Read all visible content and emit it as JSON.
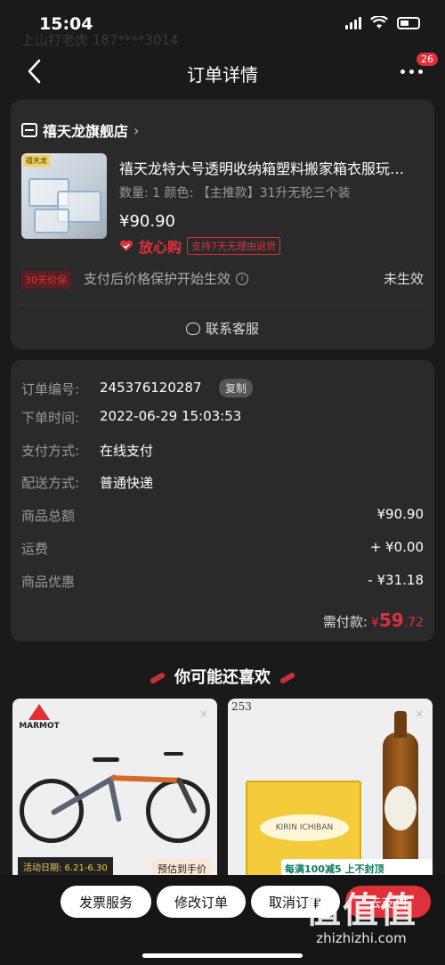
{
  "status_bar": {
    "time": "15:04"
  },
  "ghost": {
    "line1": "上山打老虎  187****3014",
    "line2": ""
  },
  "nav": {
    "title": "订单详情",
    "badge": "26"
  },
  "shop": {
    "name": "禧天龙旗舰店",
    "product": {
      "title": "禧天龙特大号透明收纳箱塑料搬家箱衣服玩…",
      "spec": "数量: 1  颜色: 【主推款】31升无轮三个装",
      "price": "¥90.90",
      "assure_text": "放心购",
      "assure_badge": "支持7天无理由退货",
      "thumb_tag": "禧天龙"
    },
    "price_protect": {
      "tag": "30天价保",
      "text": "支付后价格保护开始生效",
      "status": "未生效"
    },
    "customer_service": "联系客服"
  },
  "order_info": {
    "rows": [
      {
        "label": "订单编号:",
        "value": "245376120287"
      },
      {
        "label": "下单时间:",
        "value": "2022-06-29 15:03:53"
      },
      {
        "label": "支付方式:",
        "value": "在线支付"
      },
      {
        "label": "配送方式:",
        "value": "普通快递"
      }
    ],
    "copy_label": "复制",
    "amounts": [
      {
        "label": "商品总额",
        "value": "¥90.90"
      },
      {
        "label": "运费",
        "value": "+ ¥0.00"
      },
      {
        "label": "商品优惠",
        "value": "- ¥31.18"
      }
    ],
    "total_label": "需付款:",
    "total_symbol": "¥",
    "total_int": "59",
    "total_dec": ".72"
  },
  "recommend": {
    "title": "你可能还喜欢",
    "items": [
      {
        "brand": "MARMOT",
        "activity": "活动日期: 6.21-6.30",
        "presale": "预估到手价"
      },
      {
        "corner": "253",
        "box_label": "KIRIN ICHIBAN",
        "promo": "每满100减5 上不封顶"
      }
    ]
  },
  "bottom_bar": {
    "invoice": "发票服务",
    "modify": "修改订单",
    "cancel": "取消订单",
    "pay": "去支付"
  },
  "watermark": {
    "logo": "值值值",
    "domain": "zhizhizhi.com"
  }
}
